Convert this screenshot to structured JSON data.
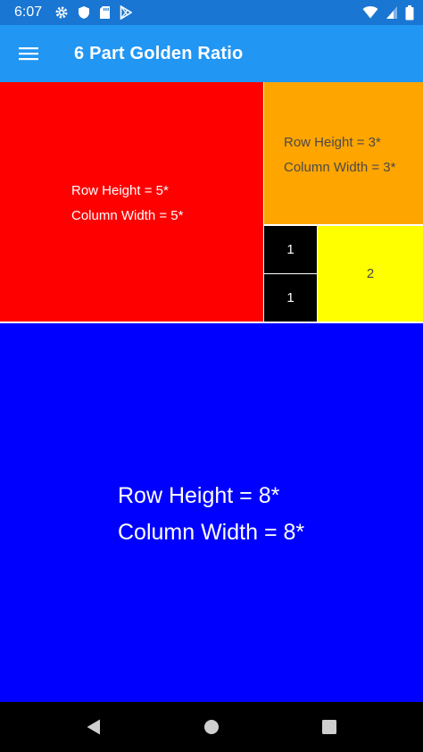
{
  "status_bar": {
    "time": "6:07",
    "left_icons": [
      "settings-icon",
      "shield-icon",
      "sd-card-icon",
      "play-store-icon"
    ],
    "right_icons": [
      "wifi-icon",
      "signal-icon",
      "battery-icon"
    ]
  },
  "app_bar": {
    "title": "6 Part Golden Ratio",
    "menu_icon": "hamburger-menu-icon"
  },
  "cells": {
    "red": {
      "line1": "Row Height = 5*",
      "line2": "Column Width = 5*",
      "color": "#ff0000"
    },
    "orange": {
      "line1": "Row Height = 3*",
      "line2": "Column Width = 3*",
      "color": "#ffa500"
    },
    "black_top": {
      "label": "1",
      "color": "#000000"
    },
    "black_bottom": {
      "label": "1",
      "color": "#000000"
    },
    "yellow": {
      "label": "2",
      "color": "#ffff00"
    },
    "blue": {
      "line1": "Row Height = 8*",
      "line2": "Column Width = 8*",
      "color": "#0000ff"
    }
  },
  "nav_bar": {
    "icons": [
      "back-icon",
      "home-icon",
      "recents-icon"
    ]
  },
  "colors": {
    "app_bar": "#2196F3",
    "status_bar": "#1976D2"
  }
}
